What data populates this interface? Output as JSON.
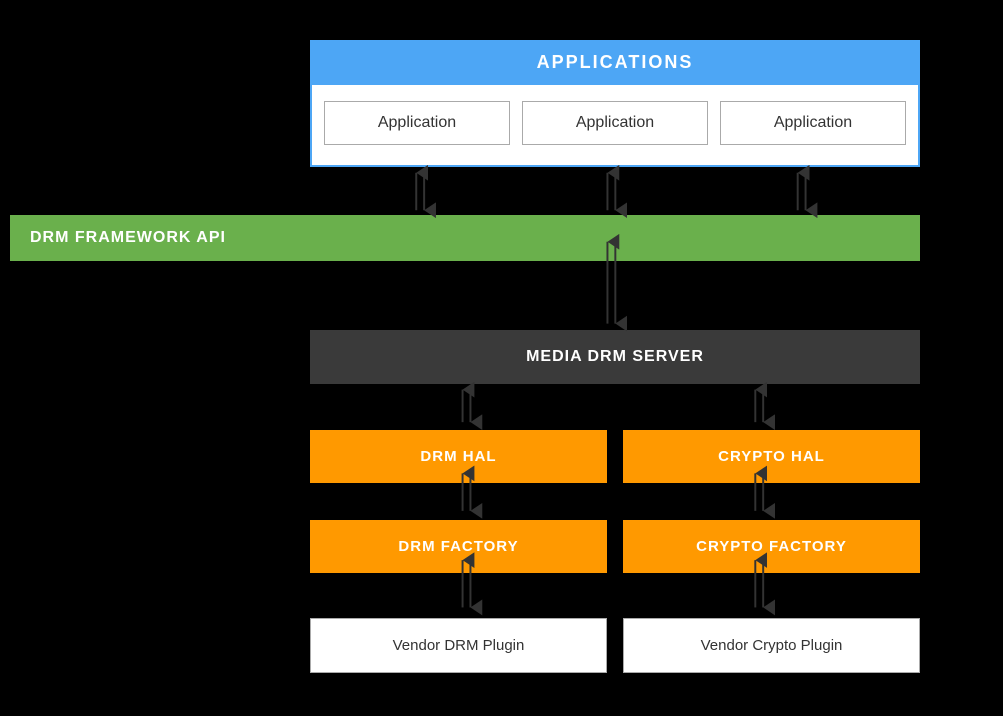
{
  "applications": {
    "header": "APPLICATIONS",
    "app1": "Application",
    "app2": "Application",
    "app3": "Application"
  },
  "drm_framework": {
    "label": "DRM FRAMEWORK API"
  },
  "media_drm_server": {
    "label": "MEDIA DRM SERVER"
  },
  "hal_row": {
    "drm_hal": "DRM HAL",
    "crypto_hal": "CRYPTO HAL"
  },
  "factory_row": {
    "drm_factory": "DRM FACTORY",
    "crypto_factory": "CRYPTO FACTORY"
  },
  "vendor_row": {
    "drm_plugin": "Vendor DRM Plugin",
    "crypto_plugin": "Vendor Crypto Plugin"
  },
  "colors": {
    "blue": "#4da6f5",
    "green": "#6ab04c",
    "orange": "#ff9900",
    "dark": "#3a3a3a",
    "white": "#ffffff",
    "black": "#000000"
  }
}
